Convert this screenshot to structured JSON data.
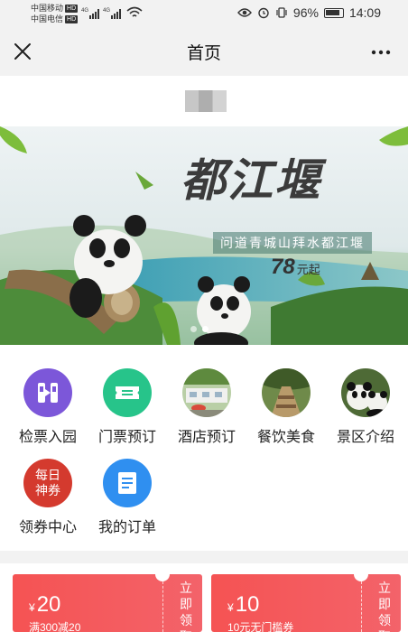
{
  "status_bar": {
    "carrier1": "中国移动",
    "carrier2": "中国电信",
    "hd_badge": "HD",
    "network1": "4G",
    "network2": "4G",
    "battery": "96%",
    "time": "14:09",
    "icons": [
      "eye-icon",
      "alarm-icon",
      "vibrate-icon",
      "battery-icon",
      "wifi-icon",
      "signal-icon"
    ]
  },
  "nav": {
    "title": "首页",
    "close_icon": "close-icon",
    "more_icon": "more-icon"
  },
  "banner": {
    "title": "都江堰",
    "subtitle": "问道青城山拜水都江堰",
    "price": "78",
    "price_unit": "元起",
    "slides": 2,
    "active_slide": 2
  },
  "menu": [
    {
      "label": "检票入园",
      "icon": "ticket-gate-icon",
      "color": "#7c57d9"
    },
    {
      "label": "门票预订",
      "icon": "ticket-icon",
      "color": "#27c48a"
    },
    {
      "label": "酒店预订",
      "icon": "hotel-photo",
      "color": "#b7c9a0"
    },
    {
      "label": "餐饮美食",
      "icon": "food-photo",
      "color": "#6f8a4a"
    },
    {
      "label": "景区介绍",
      "icon": "panda-photo",
      "color": "#4a5a3a"
    },
    {
      "label": "领券中心",
      "icon": "coupon-badge-icon",
      "badge_text": "每日神券",
      "color": "#d43a2e"
    },
    {
      "label": "我的订单",
      "icon": "order-icon",
      "color": "#2f8ff0"
    }
  ],
  "coupons": [
    {
      "currency": "¥",
      "amount": "20",
      "condition": "满300减20",
      "action": "立即领取"
    },
    {
      "currency": "¥",
      "amount": "10",
      "condition": "10元无门槛券",
      "action": "立即领取"
    }
  ],
  "colors": {
    "coupon_red": "#f55353",
    "nav_bg": "#f2f2f2"
  }
}
